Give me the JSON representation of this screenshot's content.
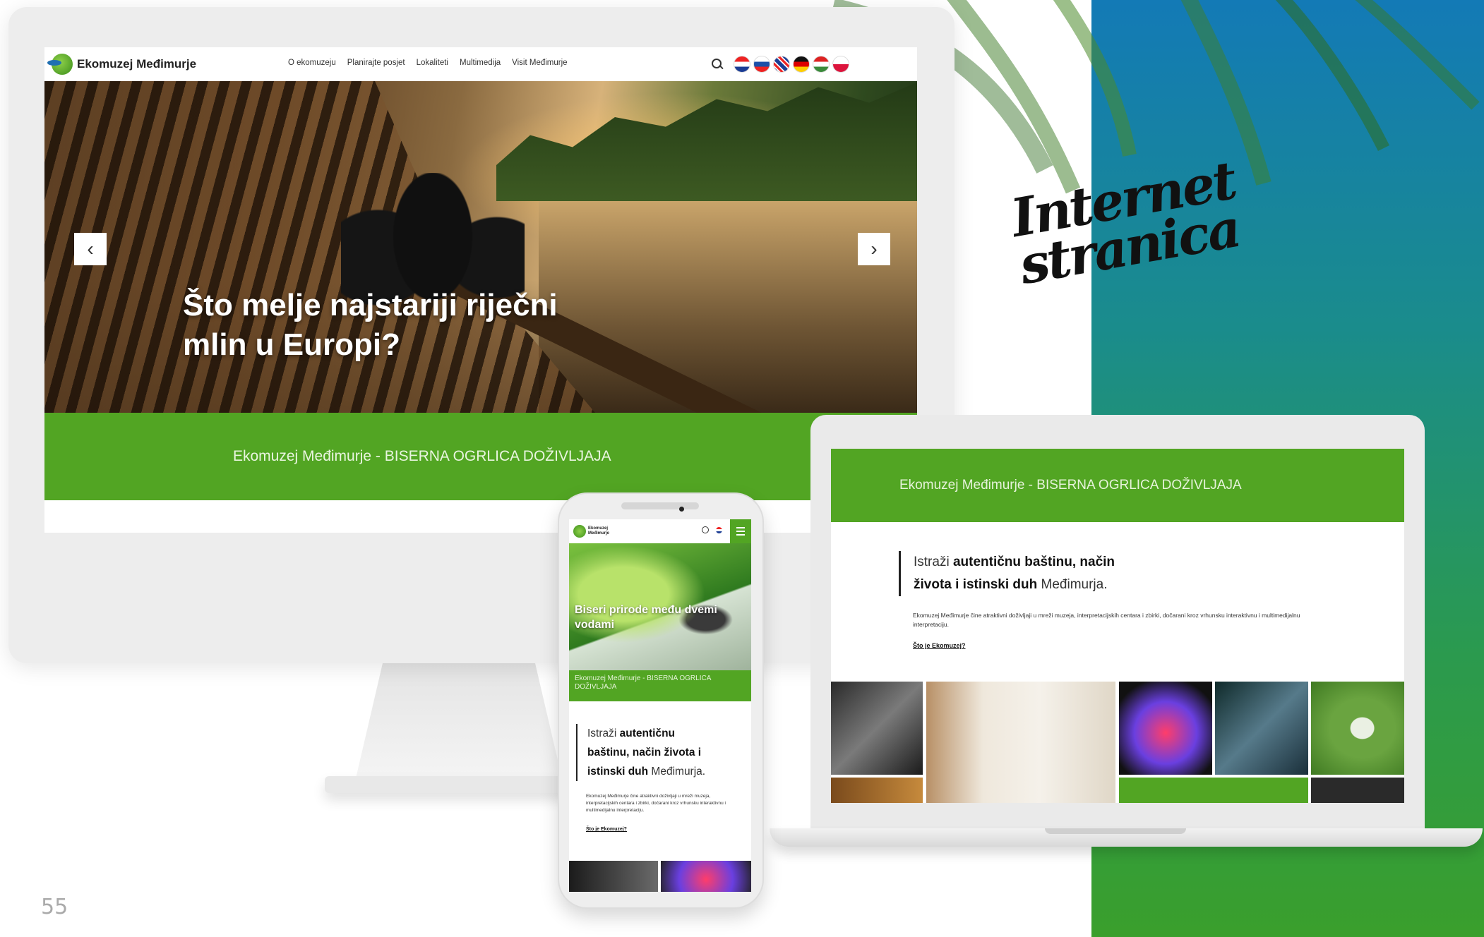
{
  "page": {
    "headline_line1": "Internet",
    "headline_line2": "stranica",
    "page_number": "55"
  },
  "colors": {
    "brand_green": "#52a523",
    "gradient_top": "#137ab6",
    "gradient_bottom": "#3a9f2c"
  },
  "site": {
    "logo_text": "Ekomuzej Međimurje",
    "nav": [
      "O ekomuzeju",
      "Planirajte posjet",
      "Lokaliteti",
      "Multimedija",
      "Visit Međimurje"
    ],
    "language_flags": [
      "hr-flag-icon",
      "si-flag-icon",
      "uk-flag-icon",
      "de-flag-icon",
      "hu-flag-icon",
      "pl-flag-icon"
    ],
    "slider_prev": "‹",
    "slider_next": "›",
    "hero_title": "Što melje najstariji riječni mlin u Europi?",
    "band_text": "Ekomuzej Međimurje - BISERNA OGRLICA DOŽIVLJAJA",
    "intro_plain1": "Istraži ",
    "intro_bold": "autentičnu baštinu, način života i istinski duh",
    "intro_plain2": " Međimurja.",
    "body_text": "Ekomuzej Međimurje čine atraktivni doživljaji u mreži muzeja, interpretacijskih centara i zbirki, dočarani kroz vrhunsku interaktivnu i multimedijalnu interpretaciju.",
    "link_text": "Što je Ekomuzej?"
  },
  "phone": {
    "logo_line1": "Ekomuzej",
    "logo_line2": "Međimurje",
    "hero_title": "Biseri prirode među dvemi vodami",
    "band_text": "Ekomuzej Međimurje - BISERNA OGRLICA DOŽIVLJAJA"
  }
}
